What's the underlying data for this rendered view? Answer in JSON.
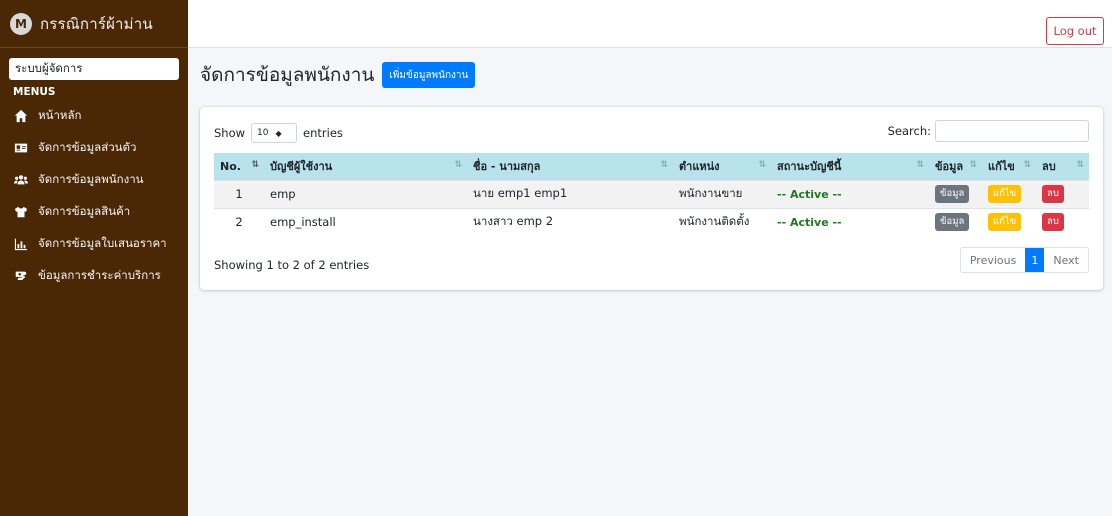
{
  "brand": {
    "logo_letter": "M",
    "name": "กรรณิการ์ผ้าม่าน"
  },
  "sidebar": {
    "user_label": "ระบบผู้จัดการ",
    "menu_header": "MENUS",
    "items": [
      {
        "label": "หน้าหลัก",
        "icon": "home-icon"
      },
      {
        "label": "จัดการข้อมูลส่วนตัว",
        "icon": "id-card-icon"
      },
      {
        "label": "จัดการข้อมูลพนักงาน",
        "icon": "users-icon"
      },
      {
        "label": "จัดการข้อมูลสินค้า",
        "icon": "shirt-icon"
      },
      {
        "label": "จัดการข้อมูลใบเสนอราคา",
        "icon": "chart-bar-icon"
      },
      {
        "label": "ข้อมูลการชำระค่าบริการ",
        "icon": "money-icon"
      }
    ]
  },
  "topbar": {
    "logout_label": "Log out"
  },
  "page": {
    "title": "จัดการข้อมูลพนักงาน",
    "add_button": "เพิ่มข้อมูลพนักงาน"
  },
  "table_controls": {
    "show_label": "Show",
    "length_value": "10",
    "entries_label": "entries",
    "search_label": "Search:"
  },
  "table": {
    "headers": [
      "No.",
      "บัญชีผู้ใช้งาน",
      "ชื่อ - นามสกุล",
      "ตำแหน่ง",
      "สถานะบัญชีนี้",
      "ข้อมูล",
      "แก้ไข",
      "ลบ"
    ],
    "rows": [
      {
        "no": "1",
        "username": "emp",
        "fullname": "นาย emp1 emp1",
        "position": "พนักงานขาย",
        "status": "-- Active --",
        "info": "ข้อมูล",
        "edit": "แก้ไข",
        "delete": "ลบ"
      },
      {
        "no": "2",
        "username": "emp_install",
        "fullname": "นางสาว emp 2",
        "position": "พนักงานติดตั้ง",
        "status": "-- Active --",
        "info": "ข้อมูล",
        "edit": "แก้ไข",
        "delete": "ลบ"
      }
    ]
  },
  "footer": {
    "info": "Showing 1 to 2 of 2 entries",
    "previous": "Previous",
    "current_page": "1",
    "next": "Next"
  },
  "colors": {
    "sidebar_bg": "#4a2806",
    "table_header_bg": "#b8e3ec",
    "primary": "#007bff",
    "danger": "#dc3545",
    "warning": "#ffc107",
    "status_active": "#1f7a1f"
  }
}
